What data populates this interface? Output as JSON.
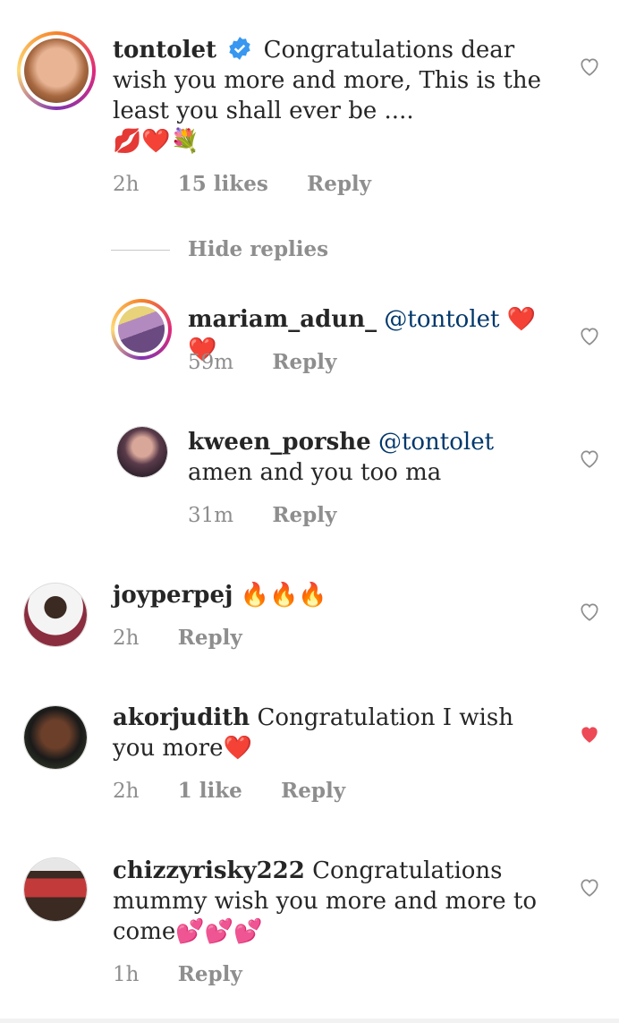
{
  "colors": {
    "text": "#262626",
    "meta": "#8e8e8e",
    "mention": "#00376b",
    "liked": "#ed4956",
    "verified": "#3897f0"
  },
  "comments": [
    {
      "username": "tontolet",
      "verified": true,
      "text": "Congratulations dear wish you more and more, This is the least you shall ever be ....",
      "emoji": "💋❤️💐",
      "time": "2h",
      "likes": "15 likes",
      "reply": "Reply",
      "liked": false
    },
    {
      "username": "mariam_adun_",
      "mention": "@tontolet",
      "text": "❤️❤️",
      "time": "59m",
      "reply": "Reply",
      "liked": false
    },
    {
      "username": "kween_porshe",
      "mention": "@tontolet",
      "text": "amen and you too ma",
      "time": "31m",
      "reply": "Reply",
      "liked": false
    },
    {
      "username": "joyperpej",
      "text": "🔥🔥🔥",
      "time": "2h",
      "reply": "Reply",
      "liked": false
    },
    {
      "username": "akorjudith",
      "text": "Congratulation I wish you more❤️",
      "time": "2h",
      "likes": "1 like",
      "reply": "Reply",
      "liked": true
    },
    {
      "username": "chizzyrisky222",
      "text": "Congratulations mummy wish you more and more to come💕💕💕",
      "time": "1h",
      "reply": "Reply",
      "liked": false
    }
  ],
  "thread": {
    "hide_replies": "Hide replies"
  }
}
